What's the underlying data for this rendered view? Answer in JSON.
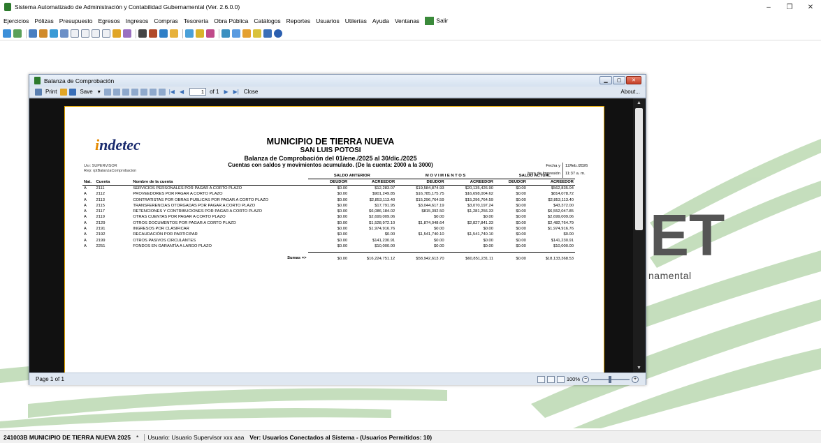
{
  "app": {
    "title": "Sistema Automatizado de Administración y Contabilidad Gubernamental (Ver. 2.6.0.0)",
    "min": "–",
    "max": "❐",
    "close": "✕"
  },
  "menu": [
    "Ejercicios",
    "Pólizas",
    "Presupuesto",
    "Egresos",
    "Ingresos",
    "Compras",
    "Tesorería",
    "Obra Pública",
    "Catálogos",
    "Reportes",
    "Usuarios",
    "Utilerías",
    "Ayuda",
    "Ventanas",
    "Salir"
  ],
  "toolbar_icons": [
    "refresh-icon",
    "calculator-icon",
    "chart-icon",
    "tools-icon",
    "edit-icon",
    "calendar-icon",
    "doc-c-icon",
    "doc-d-icon",
    "doc-e-icon",
    "doc-p-icon",
    "folder-icon",
    "pen-icon",
    "clipboard-icon",
    "car-icon",
    "book-icon",
    "box-icon",
    "report-icon",
    "group-icon",
    "person-icon",
    "grid-icon",
    "stamp-icon",
    "lightbulb-icon",
    "save-icon",
    "help-icon"
  ],
  "background": {
    "text": "namental",
    "letters": "ET"
  },
  "report_window": {
    "title": "Balanza de Comprobación",
    "toolbar": {
      "print": "Print",
      "save": "Save",
      "page_current": "1",
      "page_of": "of 1",
      "close": "Close",
      "about": "About..."
    },
    "status": {
      "page": "Page 1 of 1",
      "zoom": "100%"
    }
  },
  "report": {
    "logo": "ndetec",
    "logo_i": "i",
    "user_line": "Usr: SUPERVISOR",
    "rep_line": "Rep: rptBalanzaComprobacion",
    "municipio": "MUNICIPIO DE TIERRA NUEVA",
    "estado": "SAN LUIS POTOSI",
    "titulo": "Balanza de Comprobación del 01/ene./2025 al 30/dic./2025",
    "subtitulo": "Cuentas con saldos y movimientos acumulado. (De la cuenta: 2000 a la 3000)",
    "fecha_label": "Fecha y",
    "fecha_value": "12/feb./2026",
    "hora_label": "hora de Impresión",
    "hora_value": "11:37 a. m.",
    "groups": [
      "SALDO ANTERIOR",
      "M O V I M I E N T O S",
      "SALDO ACTUAL"
    ],
    "headers": [
      "Nat.",
      "Cuenta",
      "Nombre de la cuenta",
      "DEUDOR",
      "ACREEDOR",
      "DEUDOR",
      "ACREEDOR",
      "DEUDOR",
      "ACREEDOR"
    ],
    "rows": [
      [
        "A",
        "2111",
        "SERVICIOS PERSONALES POR PAGAR A CORTO PLAZO",
        "$0.00",
        "$12,283.07",
        "$19,584,874.93",
        "$20,135,426.90",
        "$0.00",
        "$562,835.04"
      ],
      [
        "A",
        "2112",
        "PROVEEDORES POR PAGAR A CORTO PLAZO",
        "$0.00",
        "$901,249.85",
        "$16,785,175.75",
        "$16,698,004.62",
        "$0.00",
        "$814,078.72"
      ],
      [
        "A",
        "2113",
        "CONTRATISTAS POR OBRAS PUBLICAS POR PAGAR A CORTO PLAZO",
        "$0.00",
        "$2,853,113.40",
        "$15,296,764.59",
        "$15,296,764.59",
        "$0.00",
        "$2,853,113.40"
      ],
      [
        "A",
        "2115",
        "TRANSFERENCIAS OTORGADAS POR PAGAR A CORTO PLAZO",
        "$0.00",
        "$17,791.95",
        "$3,044,617.19",
        "$3,070,197.24",
        "$0.00",
        "$43,372.00"
      ],
      [
        "A",
        "2117",
        "RETENCIONES Y CONTRIBUCIONES POR PAGAR A CORTO PLAZO",
        "$0.00",
        "$6,086,184.02",
        "$815,392.50",
        "$1,281,256.33",
        "$0.00",
        "$6,552,047.85"
      ],
      [
        "A",
        "2119",
        "OTRAS CUENTAS POR PAGAR A CORTO PLAZO",
        "$0.00",
        "$2,699,009.06",
        "$0.00",
        "$0.00",
        "$0.00",
        "$2,699,009.06"
      ],
      [
        "A",
        "2129",
        "OTROS DOCUMENTOS POR PAGAR A CORTO PLAZO",
        "$0.00",
        "$1,528,972.10",
        "$1,874,048.64",
        "$2,827,841.33",
        "$0.00",
        "$2,482,764.79"
      ],
      [
        "A",
        "2191",
        "INGRESOS POR CLASIFICAR",
        "$0.00",
        "$1,974,916.76",
        "$0.00",
        "$0.00",
        "$0.00",
        "$1,974,916.76"
      ],
      [
        "A",
        "2192",
        "RECAUDACIÓN POR PARTICIPAR",
        "$0.00",
        "$0.00",
        "$1,541,740.10",
        "$1,541,740.10",
        "$0.00",
        "$0.00"
      ],
      [
        "A",
        "2199",
        "OTROS PASIVOS CIRCULANTES",
        "$0.00",
        "$141,230.91",
        "$0.00",
        "$0.00",
        "$0.00",
        "$141,230.91"
      ],
      [
        "A",
        "2251",
        "FONDOS EN GARANTÍA A LARGO PLAZO",
        "$0.00",
        "$10,000.00",
        "$0.00",
        "$0.00",
        "$0.00",
        "$10,000.00"
      ]
    ],
    "sumas_label": "Sumas =>",
    "sumas": [
      "$0.00",
      "$16,224,751.12",
      "$58,942,613.70",
      "$60,851,231.11",
      "$0.00",
      "$18,133,368.53"
    ]
  },
  "statusbar": {
    "entity": "241003B MUNICIPIO DE TIERRA NUEVA  2025",
    "star": "*",
    "user": "Usuario: Usuario Supervisor xxx aaa",
    "connected": "Ver: Usuarios Conectados al Sistema - (Usuarios Permitidos: 10)"
  }
}
